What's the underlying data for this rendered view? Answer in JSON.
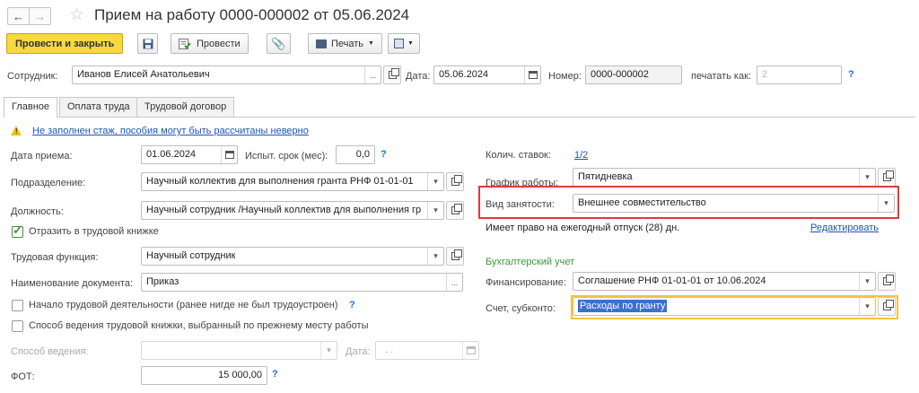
{
  "header": {
    "title": "Прием на работу 0000-000002 от 05.06.2024"
  },
  "toolbar": {
    "post_close": "Провести и закрыть",
    "post": "Провести",
    "print": "Печать"
  },
  "top": {
    "employee_label": "Сотрудник:",
    "employee_value": "Иванов Елисей Анатольевич",
    "date_label": "Дата:",
    "date_value": "05.06.2024",
    "number_label": "Номер:",
    "number_value": "0000-000002",
    "print_as_label": "печатать как:",
    "print_as_placeholder": "2"
  },
  "tabs": [
    {
      "label": "Главное"
    },
    {
      "label": "Оплата труда"
    },
    {
      "label": "Трудовой договор"
    }
  ],
  "warning": {
    "text": "Не заполнен стаж, пособия могут быть рассчитаны неверно"
  },
  "left": {
    "hire_date_label": "Дата приема:",
    "hire_date_value": "01.06.2024",
    "probation_label": "Испыт. срок (мес):",
    "probation_value": "0,0",
    "dept_label": "Подразделение:",
    "dept_value": "Научный коллектив для выполнения гранта РНФ 01-01-01",
    "position_label": "Должность:",
    "position_value": "Научный сотрудник /Научный коллектив для выполнения гр",
    "workbook_cb_label": "Отразить в трудовой книжке",
    "labor_func_label": "Трудовая функция:",
    "labor_func_value": "Научный сотрудник",
    "doc_name_label": "Наименование документа:",
    "doc_name_value": "Приказ",
    "start_activity_label": "Начало трудовой деятельности (ранее нигде не был трудоустроен)",
    "method_cb_label": "Способ ведения трудовой книжки, выбранный по прежнему месту работы",
    "method_label": "Способ ведения:",
    "method_date_label": "Дата:",
    "method_date_value": ". .",
    "fot_label": "ФОТ:",
    "fot_value": "15 000,00"
  },
  "right": {
    "rates_label": "Колич. ставок:",
    "rates_value": "1/2",
    "schedule_label": "График работы:",
    "schedule_value": "Пятидневка",
    "employment_label": "Вид занятости:",
    "employment_value": "Внешнее совместительство",
    "vacation_text": "Имеет право на ежегодный отпуск (28) дн.",
    "edit_link": "Редактировать",
    "accounting_title": "Бухгалтерский учет",
    "financing_label": "Финансирование:",
    "financing_value": "Соглашение РНФ 01-01-01 от 10.06.2024",
    "account_label": "Счет, субконто:",
    "account_value": "Расходы по гранту"
  },
  "colors": {
    "primary_button": "#f5d73a",
    "link": "#1a56b8",
    "highlight_red": "#e0393e",
    "highlight_yellow": "#f5c242",
    "accounting_green": "#3a9a3a",
    "selection": "#3d6fd1"
  }
}
